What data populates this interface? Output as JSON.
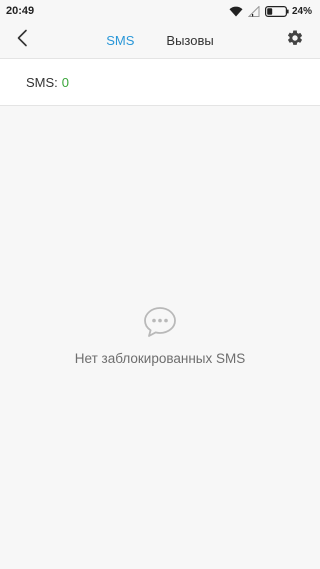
{
  "status_bar": {
    "time": "20:49",
    "battery_percent": "24%",
    "icons": [
      "wifi-icon",
      "signal-icon",
      "battery-icon"
    ]
  },
  "toolbar": {
    "back_icon": "chevron-left-icon",
    "tabs": [
      {
        "label": "SMS",
        "active": true
      },
      {
        "label": "Вызовы",
        "active": false
      }
    ],
    "settings_icon": "gear-icon"
  },
  "counter": {
    "label": "SMS:",
    "value": "0"
  },
  "empty_state": {
    "icon": "chat-bubble-icon",
    "message": "Нет заблокированных SMS"
  },
  "colors": {
    "accent": "#2a97d8",
    "count_green": "#3aa63a",
    "background": "#f7f7f7"
  }
}
